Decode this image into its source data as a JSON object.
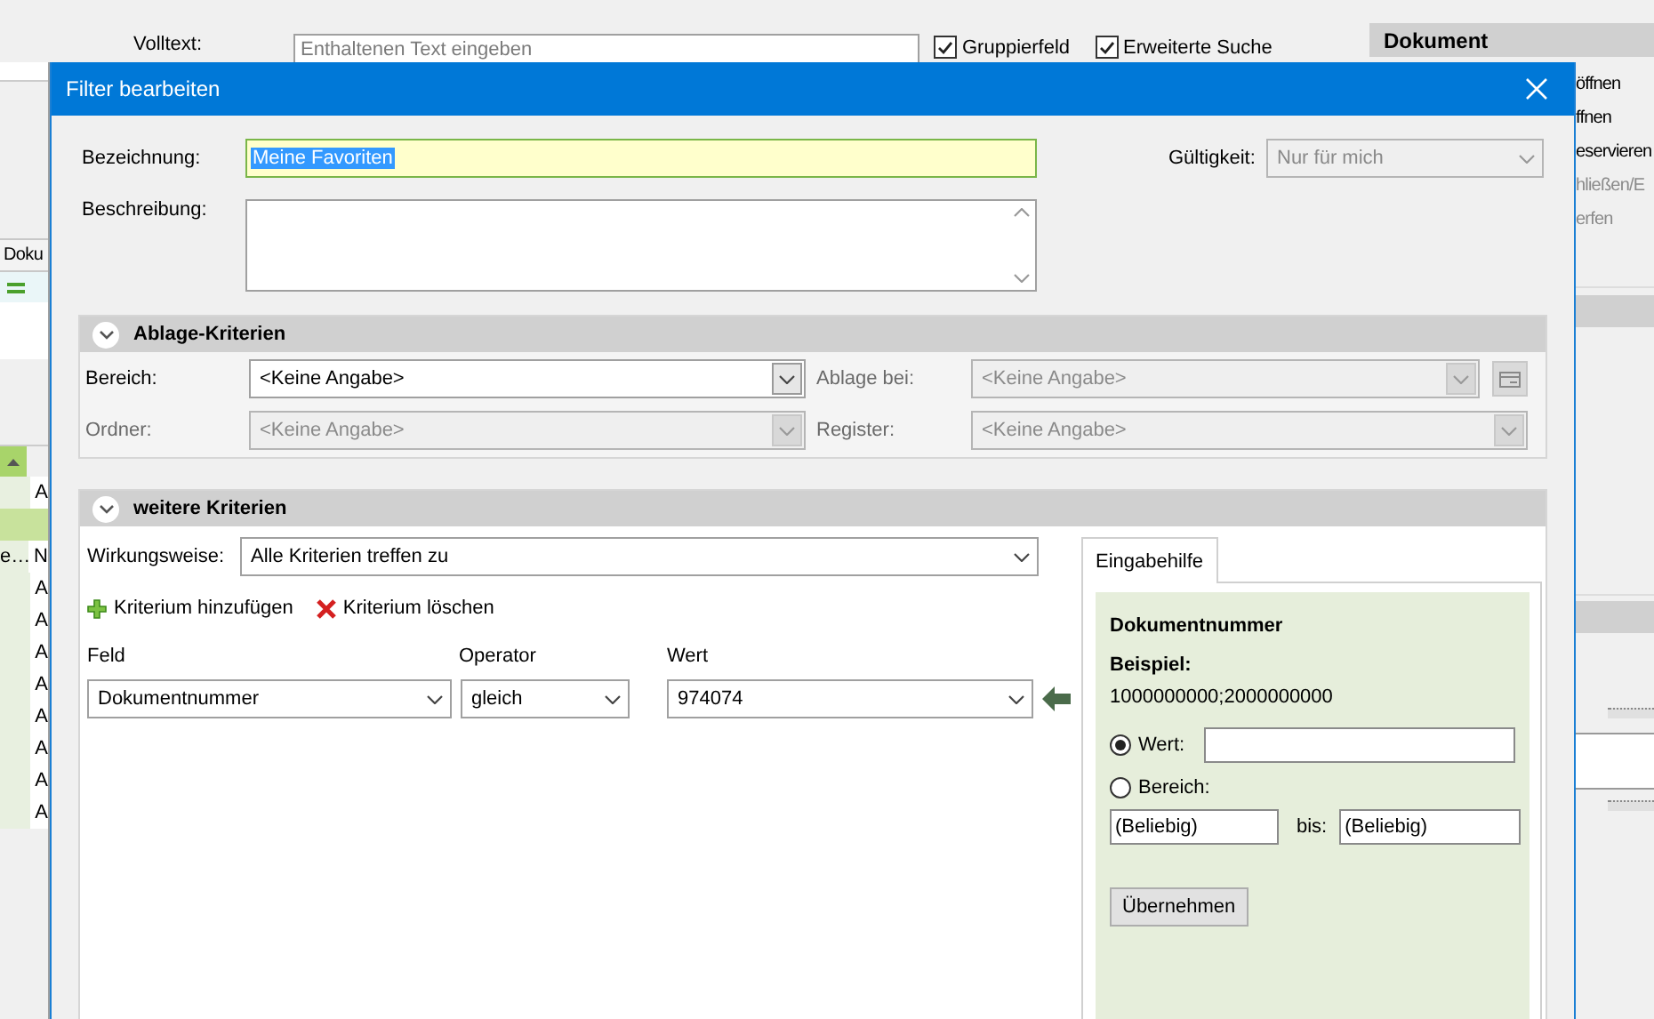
{
  "background": {
    "fulltext_label": "Volltext:",
    "fulltext_placeholder": "Enthaltenen Text eingeben",
    "checkboxes": [
      {
        "label": "Gruppierfeld",
        "checked": true
      },
      {
        "label": "Erweiterte Suche",
        "checked": true
      }
    ],
    "left_list": {
      "column": "Doku",
      "rows": [
        {
          "col_2": "A",
          "selected": false
        },
        {
          "selected": true
        },
        {
          "col_1": "e…",
          "col_2": "N",
          "selected": false
        },
        {
          "col_2": "A",
          "selected": false
        },
        {
          "col_2": "A",
          "selected": false
        },
        {
          "col_2": "A",
          "selected": false
        },
        {
          "col_2": "A",
          "selected": false
        },
        {
          "col_2": "A",
          "selected": false
        },
        {
          "col_2": "A",
          "selected": false
        },
        {
          "col_2": "A",
          "selected": false
        },
        {
          "col_2": "A",
          "selected": false
        }
      ]
    },
    "right_panel": {
      "title": "Dokument",
      "items": [
        {
          "label": "öffnen",
          "disabled": false
        },
        {
          "label": "ffnen",
          "disabled": false
        },
        {
          "label": "eservieren",
          "disabled": false
        },
        {
          "label": "hließen/E",
          "disabled": true
        },
        {
          "label": "erfen",
          "disabled": true
        }
      ]
    }
  },
  "dialog": {
    "title": "Filter bearbeiten",
    "name_label": "Bezeichnung:",
    "name_value": "Meine Favoriten",
    "description_label": "Beschreibung:",
    "validity_label": "Gültigkeit:",
    "validity_value": "Nur für mich",
    "validity_disabled": true,
    "storage_section": {
      "title": "Ablage-Kriterien",
      "expanded": true,
      "fields": [
        {
          "label": "Bereich:",
          "value": "<Keine Angabe>",
          "disabled": false
        },
        {
          "label": "Ablage bei:",
          "value": "<Keine Angabe>",
          "disabled": true
        },
        {
          "label": "Ordner:",
          "value": "<Keine Angabe>",
          "disabled": true
        },
        {
          "label": "Register:",
          "value": "<Keine Angabe>",
          "disabled": true
        }
      ]
    },
    "criteria_section": {
      "title": "weitere Kriterien",
      "expanded": true,
      "mode_label": "Wirkungsweise:",
      "mode_value": "Alle Kriterien treffen zu",
      "actions": [
        {
          "kind": "add",
          "label": "Kriterium hinzufügen"
        },
        {
          "kind": "delete",
          "label": "Kriterium löschen"
        }
      ],
      "columns": [
        "Feld",
        "Operator",
        "Wert"
      ],
      "rows": [
        {
          "field": "Dokumentnummer",
          "operator": "gleich",
          "value": "974074"
        }
      ]
    },
    "help": {
      "tabs": [
        {
          "label": "Eingabehilfe",
          "selected": true
        }
      ],
      "heading": "Dokumentnummer",
      "example_label": "Beispiel:",
      "example_value": "1000000000;2000000000",
      "options": [
        {
          "label": "Wert:",
          "selected": true
        },
        {
          "label": "Bereich:",
          "selected": false
        }
      ],
      "range_from": "(Beliebig)",
      "range_to_label": "bis:",
      "range_to": "(Beliebig)",
      "apply_button": "Übernehmen"
    }
  }
}
